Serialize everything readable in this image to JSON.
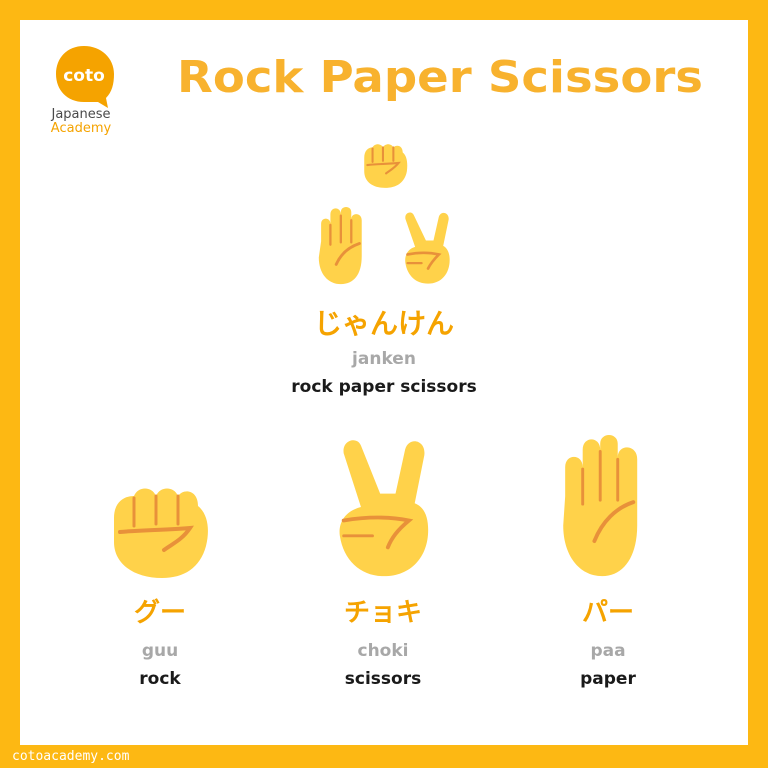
{
  "logo": {
    "badge_text": "coto",
    "line1": "Japanese",
    "line2": "Academy"
  },
  "title": "Rock Paper Scissors",
  "main": {
    "japanese": "じゃんけん",
    "romaji": "janken",
    "english": "rock paper scissors"
  },
  "items": [
    {
      "japanese": "グー",
      "romaji": "guu",
      "english": "rock",
      "icon": "fist-icon"
    },
    {
      "japanese": "チョキ",
      "romaji": "choki",
      "english": "scissors",
      "icon": "peace-hand-icon"
    },
    {
      "japanese": "パー",
      "romaji": "paa",
      "english": "paper",
      "icon": "open-hand-icon"
    }
  ],
  "footer": "cotoacademy.com",
  "colors": {
    "frame": "#FDB813",
    "accent": "#F5A300",
    "title": "#F8B22E",
    "hand": "#FFD24A",
    "hand_line": "#E8913A",
    "romaji": "#A8A8A8",
    "text": "#1A1A1A"
  }
}
